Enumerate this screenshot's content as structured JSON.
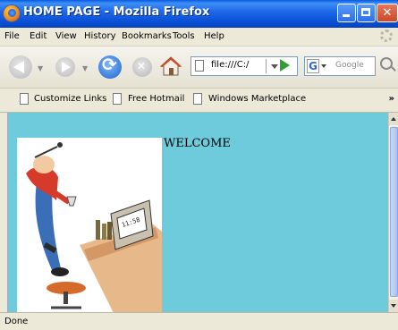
{
  "window": {
    "title": "HOME PAGE - Mozilla Firefox"
  },
  "menu": [
    "File",
    "Edit",
    "View",
    "History",
    "Bookmarks",
    "Tools",
    "Help"
  ],
  "nav": {
    "url": "file:///C:/",
    "search_placeholder": "Google"
  },
  "bookmarks": [
    "Customize Links",
    "Free Hotmail",
    "Windows Marketplace"
  ],
  "bookmarks_more": "»",
  "page": {
    "welcome_text": "WELCOME",
    "background_color": "#6ecbdb"
  },
  "status": {
    "text": "Done"
  }
}
